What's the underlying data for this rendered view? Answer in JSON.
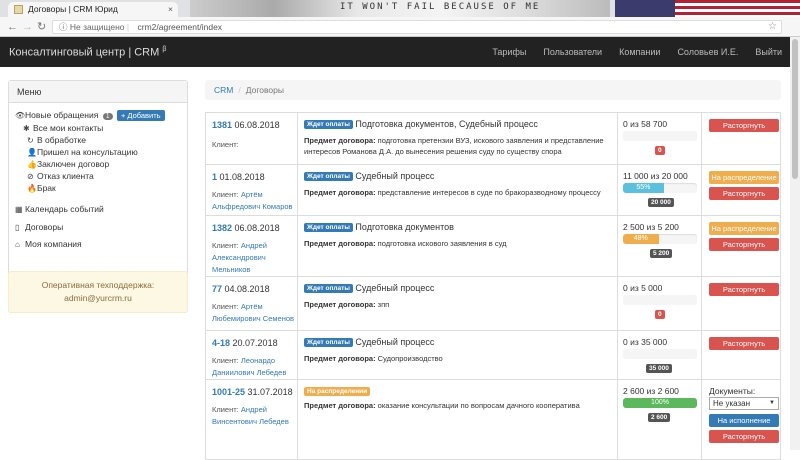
{
  "browser": {
    "tab_title": "Договоры | CRM Юрид",
    "banner_text": "IT WON'T FAIL BECAUSE OF ME",
    "security": "Не защищено",
    "url": "crm2/agreement/index"
  },
  "navbar": {
    "brand": "Консалтинговый центр | CRM",
    "brand_sup": "β",
    "links": [
      "Тарифы",
      "Пользователи",
      "Компании",
      "Соловьев И.Е.",
      "Выйти"
    ]
  },
  "sidebar": {
    "header": "Меню",
    "new_requests": "Новые обращения",
    "new_count": "1",
    "add_label": "+ Добавить",
    "all_contacts": "Все мои контакты",
    "in_progress": "В обработке",
    "came": "Пришел на консультацию",
    "contract": "Заключен договор",
    "refusal": "Отказ клиента",
    "defect": "Брак",
    "calendar": "Календарь событий",
    "contracts": "Договоры",
    "company": "Моя компания"
  },
  "support": {
    "title": "Оперативная техподдержка:",
    "email": "admin@yurcrm.ru"
  },
  "breadcrumb": {
    "root": "CRM",
    "current": "Договоры"
  },
  "labels": {
    "client": "Клиент:",
    "subject": "Предмет договора:",
    "documents": "Документы:"
  },
  "rows": [
    {
      "num": "1381",
      "date": "06.08.2018",
      "client": "",
      "status": "Ждет оплаты",
      "title": "Подготовка документов, Судебный процесс",
      "subject": "подготовка претензии ВУЗ, искового заявления и представление интересов Романова Д.А. до вынесения решения суду по существу спора",
      "paid": "0 из 58 700",
      "progress": 0,
      "progress_label": "",
      "debt": "0",
      "btn1": "",
      "btn2": "Расторгнуть"
    },
    {
      "num": "1",
      "date": "01.08.2018",
      "client": "Артём Альфредович Комаров",
      "status": "Ждет оплаты",
      "title": "Судебный процесс",
      "subject": "представление интересов в суде по бракоразводному процессу",
      "paid": "11 000 из 20 000",
      "progress": 55,
      "progress_label": "55%",
      "debt": "20 000",
      "btn1": "На распределение",
      "btn2": "Расторгнуть"
    },
    {
      "num": "1382",
      "date": "06.08.2018",
      "client": "Андрей Александрович Мельников",
      "status": "Ждет оплаты",
      "title": "Подготовка документов",
      "subject": "подготовка искового заявления в суд",
      "paid": "2 500 из 5 200",
      "progress": 48,
      "progress_label": "48%",
      "debt": "5 200",
      "btn1": "На распределение",
      "btn2": "Расторгнуть"
    },
    {
      "num": "77",
      "date": "04.08.2018",
      "client": "Артём Любемирович Семенов",
      "status": "Ждет оплаты",
      "title": "Судебный процесс",
      "subject": "зпп",
      "paid": "0 из 5 000",
      "progress": 0,
      "progress_label": "",
      "debt": "0",
      "btn1": "",
      "btn2": "Расторгнуть"
    },
    {
      "num": "4-18",
      "date": "20.07.2018",
      "client": "Леонардо Даниилович Лебедев",
      "status": "Ждет оплаты",
      "title": "Судебный процесс",
      "subject": "Судопроизводство",
      "paid": "0 из 35 000",
      "progress": 0,
      "progress_label": "",
      "debt": "35 000",
      "btn1": "",
      "btn2": "Расторгнуть"
    },
    {
      "num": "1001-25",
      "date": "31.07.2018",
      "client": "Андрей Винсентович Лебедев",
      "status": "На распределении",
      "title": "",
      "subject": "оказание консультации по вопросам дачного кооператива",
      "paid": "2 600 из 2 600",
      "progress": 100,
      "progress_label": "100%",
      "debt": "2 600",
      "doc_value": "Не указан",
      "btn_exec": "На исполнение",
      "btn2": "Расторгнуть"
    }
  ]
}
